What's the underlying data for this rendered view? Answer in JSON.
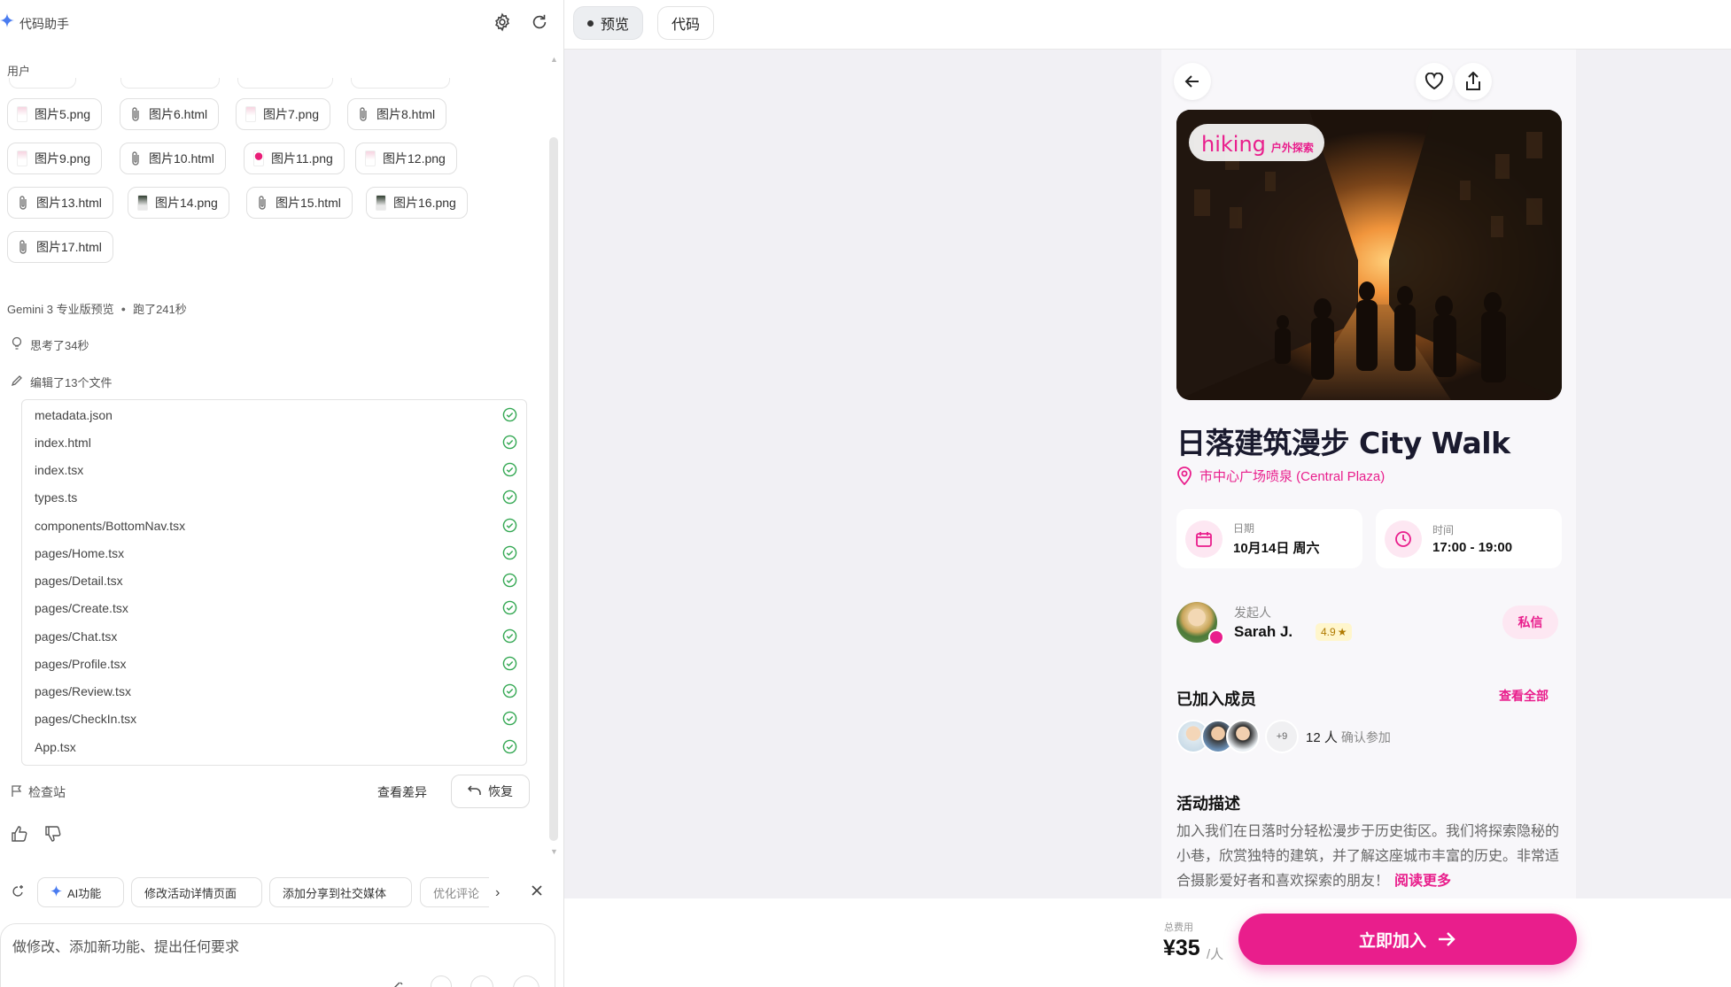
{
  "left_panel": {
    "title": "代码助手",
    "user_label": "用户",
    "attachments": [
      {
        "name": "图片5.png"
      },
      {
        "name": "图片6.html"
      },
      {
        "name": "图片7.png"
      },
      {
        "name": "图片8.html"
      },
      {
        "name": "图片9.png"
      },
      {
        "name": "图片10.html"
      },
      {
        "name": "图片11.png"
      },
      {
        "name": "图片12.png"
      },
      {
        "name": "图片13.html"
      },
      {
        "name": "图片14.png"
      },
      {
        "name": "图片15.html"
      },
      {
        "name": "图片16.png"
      },
      {
        "name": "图片17.html"
      }
    ],
    "model_info": "Gemini 3 专业版预览",
    "run_time": "跑了241秒",
    "thought": "思考了34秒",
    "edited": "编辑了13个文件",
    "files": [
      "metadata.json",
      "index.html",
      "index.tsx",
      "types.ts",
      "components/BottomNav.tsx",
      "pages/Home.tsx",
      "pages/Detail.tsx",
      "pages/Create.tsx",
      "pages/Chat.tsx",
      "pages/Profile.tsx",
      "pages/Review.tsx",
      "pages/CheckIn.tsx",
      "App.tsx"
    ],
    "checkpoint": "检查站",
    "view_diff": "查看差异",
    "restore": "恢复",
    "suggestions": [
      "AI功能",
      "修改活动详情页面",
      "添加分享到社交媒体",
      "优化评论"
    ],
    "input_placeholder": "做修改、添加新功能、提出任何要求"
  },
  "tabs": {
    "preview": "预览",
    "code": "代码"
  },
  "event": {
    "badge_en": "hiking",
    "badge_zh": "户外探索",
    "title": "日落建筑漫步 City Walk",
    "location": "市中心广场喷泉 (Central Plaza)",
    "date_label": "日期",
    "date_value": "10月14日 周六",
    "time_label": "时间",
    "time_value": "17:00 - 19:00",
    "host_label": "发起人",
    "host_name": "Sarah J.",
    "host_rating": "4.9",
    "dm_label": "私信",
    "members_title": "已加入成员",
    "see_all": "查看全部",
    "members_more": "+9",
    "members_count": "12 人",
    "members_count_sub": "确认参加",
    "desc_title": "活动描述",
    "desc_text": "加入我们在日落时分轻松漫步于历史街区。我们将探索隐秘的小巷，欣赏独特的建筑，并了解这座城市丰富的历史。非常适合摄影爱好者和喜欢探索的朋友！",
    "read_more": "阅读更多",
    "price_label": "总费用",
    "price": "¥35",
    "price_unit": "/人",
    "join_label": "立即加入"
  },
  "colors": {
    "accent": "#e91e8c",
    "accent_soft": "#fde7f2",
    "check_green": "#34a853"
  }
}
